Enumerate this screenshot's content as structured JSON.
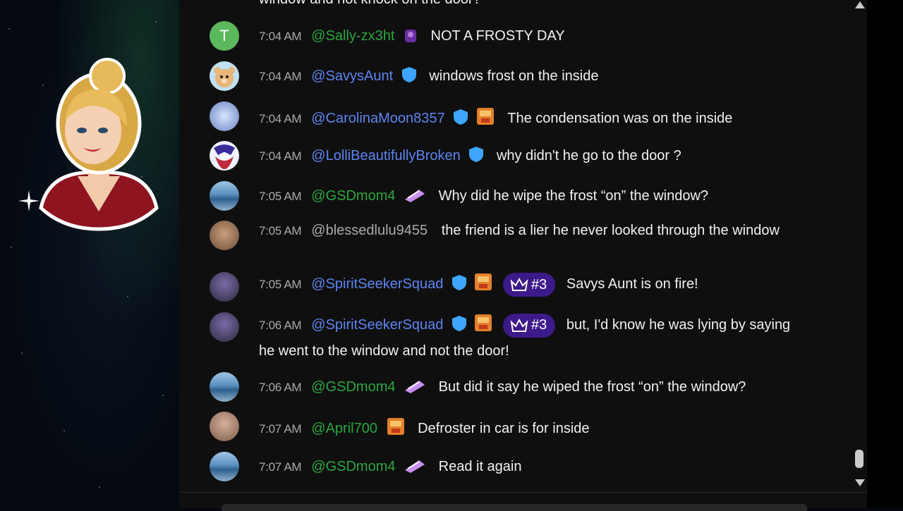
{
  "chat": {
    "top_partial": "window and not knock on the door?",
    "messages": [
      {
        "avatar": "letter-avatar",
        "avatar_letter": "T",
        "avatar_color": "#5cb85c",
        "time": "7:04 AM",
        "author": "@Sally-zx3ht",
        "author_color": "green",
        "badges": [
          "membership-badge"
        ],
        "text": "NOT A FROSTY DAY"
      },
      {
        "avatar": "teddy-bear-avatar",
        "time": "7:04 AM",
        "author": "@SavysAunt",
        "author_color": "blue",
        "badges": [
          "moderator-shield"
        ],
        "text": "windows frost on the inside"
      },
      {
        "avatar": "crystal-lotus-avatar",
        "time": "7:04 AM",
        "author": "@CarolinaMoon8357",
        "author_color": "blue",
        "badges": [
          "moderator-shield",
          "member-badge"
        ],
        "text": "The condensation was on the inside"
      },
      {
        "avatar": "cartoon-avatar",
        "time": "7:04 AM",
        "author": "@LolliBeautifullyBroken",
        "author_color": "blue",
        "badges": [
          "moderator-shield"
        ],
        "text": "why didn't he go to the door ?"
      },
      {
        "avatar": "ocean-avatar",
        "time": "7:05 AM",
        "author": "@GSDmom4",
        "author_color": "green",
        "badges": [
          "member-sticker"
        ],
        "text": "Why did he wipe the frost “on” the window?"
      },
      {
        "avatar": "dog-avatar",
        "time": "7:05 AM",
        "author": "@blessedlulu9455",
        "author_color": "gray",
        "badges": [],
        "text": "the friend is a lier he never looked through the window"
      },
      {
        "avatar": "portrait-avatar",
        "time": "7:05 AM",
        "author": "@SpiritSeekerSquad",
        "author_color": "blue",
        "badges": [
          "moderator-shield",
          "member-badge"
        ],
        "rank": "#3",
        "text": "Savys Aunt is on fire!"
      },
      {
        "avatar": "portrait-avatar",
        "time": "7:06 AM",
        "author": "@SpiritSeekerSquad",
        "author_color": "blue",
        "badges": [
          "moderator-shield",
          "member-badge"
        ],
        "rank": "#3",
        "text": "but, I'd know he was lying by saying he went to the window and not the door!"
      },
      {
        "avatar": "ocean-avatar",
        "time": "7:06 AM",
        "author": "@GSDmom4",
        "author_color": "green",
        "badges": [
          "member-sticker"
        ],
        "text": "But did it say he wiped the frost “on” the window?"
      },
      {
        "avatar": "woman-avatar",
        "time": "7:07 AM",
        "author": "@April700",
        "author_color": "green",
        "badges": [
          "member-badge"
        ],
        "text": "Defroster in car is for inside"
      },
      {
        "avatar": "ocean-avatar",
        "time": "7:07 AM",
        "author": "@GSDmom4",
        "author_color": "green",
        "badges": [
          "member-sticker"
        ],
        "text": "Read it again"
      }
    ]
  },
  "colors": {
    "chat_bg": "#0f0f0f",
    "member_green": "#2ba640",
    "moderator_blue": "#5e84f1",
    "rank_purple": "#3d1a8a"
  }
}
